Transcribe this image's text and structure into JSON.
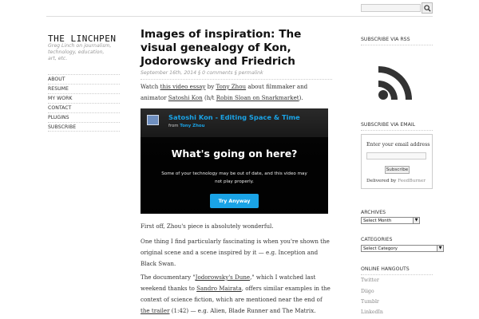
{
  "site": {
    "title": "The Linchpen",
    "tagline": "Greg Linch on journalism, technology, education, art, etc."
  },
  "nav": [
    "About",
    "Resume",
    "My Work",
    "Contact",
    "Plugins",
    "Subscribe"
  ],
  "post": {
    "title": "Images of inspiration: The visual genealogy of Kon, Jodorowsky and Friedrich",
    "meta": "September 16th, 2014 § 0 comments § permalink",
    "para1": {
      "t1": "Watch ",
      "l1": "this video essay",
      "t2": " by ",
      "l2": "Tony Zhou",
      "t3": " about filmmaker and animator ",
      "l3": "Satoshi Kon",
      "t4": " (h/t ",
      "l4": "Robin Sloan on Snarkmarket",
      "t5": ")."
    },
    "para2": "First off, Zhou's piece is absolutely wonderful.",
    "para3": "One thing I find particularly fascinating is when you're shown the original scene and a scene inspired by it — e.g. Inception and Black Swan.",
    "para4": {
      "t1": "The documentary \"",
      "l1": "Jodorowsky's Dune",
      "t2": ",\" which I watched last weekend thanks to ",
      "l2": "Sandro Mairata",
      "t3": ", offers similar examples in the context of science fiction, which are mentioned near the end of ",
      "l3": "the trailer",
      "t4": " (1:42) — e.g. Alien, Blade Runner and The Matrix."
    }
  },
  "video": {
    "title": "Satoshi Kon - Editing Space & Time",
    "from": "from",
    "author": "Tony Zhou",
    "heading": "What's going on here?",
    "message": "Some of your technology may be out of date, and this video may not play properly.",
    "button": "Try Anyway"
  },
  "sidebar": {
    "rss_heading": "Subscribe via RSS",
    "email_heading": "Subscribe via Email",
    "email_label": "Enter your email address",
    "subscribe_button": "Subscribe",
    "delivered_by": "Delivered by",
    "feedburner": "FeedBurner",
    "archives_heading": "Archives",
    "archives_select": "Select Month",
    "categories_heading": "Categories",
    "categories_select": "Select Category",
    "hangouts_heading": "Online Hangouts",
    "hangouts": [
      "Twitter",
      "Diigo",
      "Tumblr",
      "LinkedIn"
    ]
  }
}
